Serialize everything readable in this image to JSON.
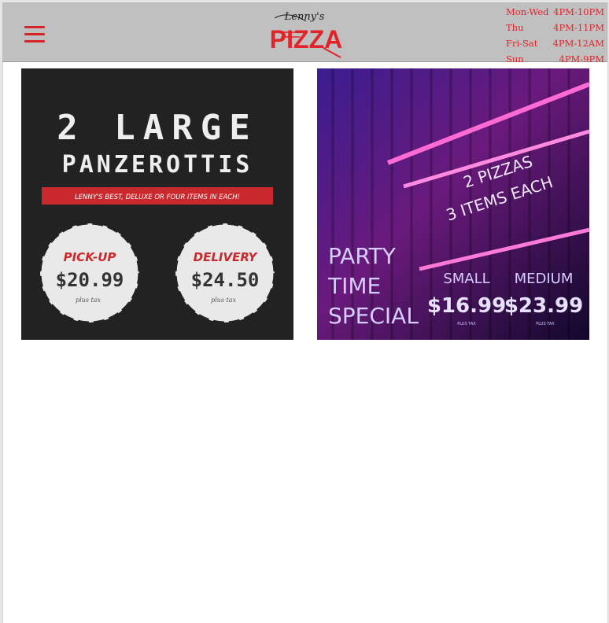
{
  "header": {
    "logo": {
      "script": "Lenny's",
      "word": "PIZZA"
    },
    "hours": [
      {
        "days": "Mon-Wed",
        "time": "4PM-10PM"
      },
      {
        "days": "Thu",
        "time": "4PM-11PM"
      },
      {
        "days": "Fri-Sat",
        "time": "4PM-12AM"
      },
      {
        "days": "Sun",
        "time": "4PM-9PM"
      }
    ]
  },
  "promos": [
    {
      "line1": "2 LARGE",
      "line2": "PANZEROTTIS",
      "banner": "LENNY'S BEST, DELUXE OR FOUR ITEMS IN EACH!",
      "pickup": {
        "label": "PICK-UP",
        "price": "$20.99",
        "tax": "plus tax"
      },
      "delivery": {
        "label": "DELIVERY",
        "price": "$24.50",
        "tax": "plus tax"
      }
    },
    {
      "line1": "2 PIZZAS",
      "line2": "3 ITEMS EACH",
      "special": [
        "PARTY",
        "TIME",
        "SPECIAL"
      ],
      "small": {
        "label": "SMALL",
        "price": "$16.99",
        "tax": "PLUS TAX"
      },
      "medium": {
        "label": "MEDIUM",
        "price": "$23.99",
        "tax": "PLUS TAX"
      }
    }
  ],
  "colors": {
    "brand_red": "#e0242a",
    "header_bg": "#c0c0c0"
  }
}
